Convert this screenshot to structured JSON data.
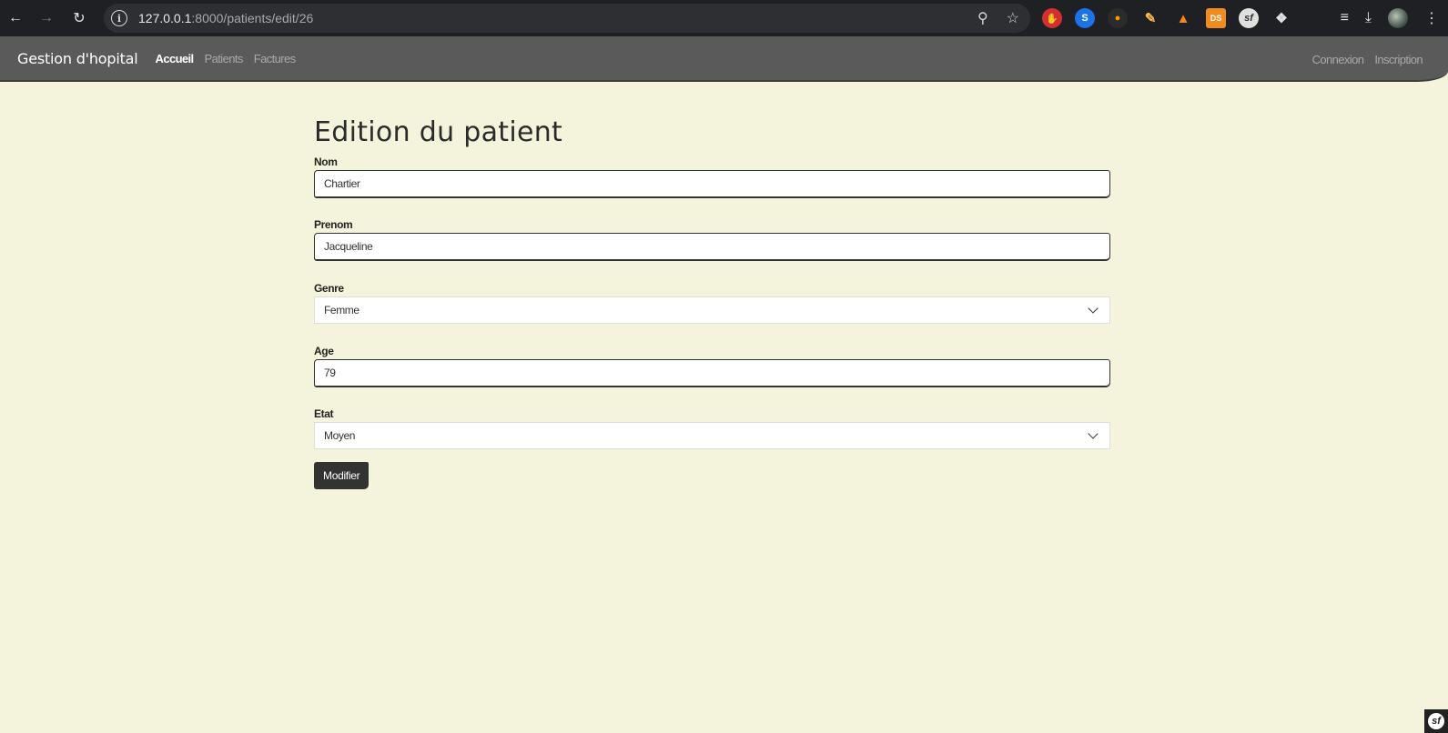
{
  "browser": {
    "url_host": "127.0.0.1",
    "url_rest": ":8000/patients/edit/26",
    "extensions": [
      "adblock-icon",
      "shazam-icon",
      "firebase-icon",
      "pen-icon",
      "metamask-icon",
      "ds-icon",
      "symfony-icon"
    ],
    "ds_label": "DS"
  },
  "navbar": {
    "brand": "Gestion d'hopital",
    "links": [
      {
        "label": "Accueil",
        "active": true
      },
      {
        "label": "Patients",
        "active": false
      },
      {
        "label": "Factures",
        "active": false
      }
    ],
    "right_links": [
      "Connexion",
      "Inscription"
    ]
  },
  "form": {
    "title": "Edition du patient",
    "fields": {
      "nom": {
        "label": "Nom",
        "value": "Chartier"
      },
      "prenom": {
        "label": "Prenom",
        "value": "Jacqueline"
      },
      "genre": {
        "label": "Genre",
        "value": "Femme"
      },
      "age": {
        "label": "Age",
        "value": "79"
      },
      "etat": {
        "label": "Etat",
        "value": "Moyen"
      }
    },
    "submit_label": "Modifier"
  },
  "colors": {
    "page_bg": "#f4f4dc",
    "navbar_bg": "#5a5a5a",
    "button_bg": "#333333"
  }
}
